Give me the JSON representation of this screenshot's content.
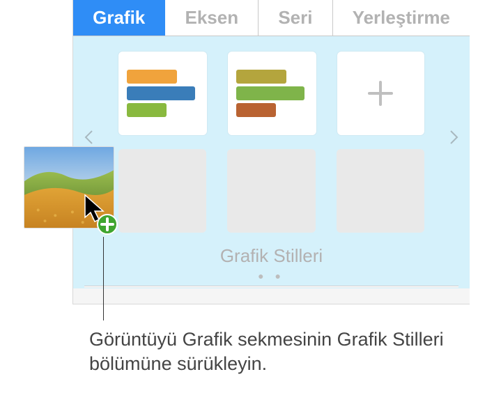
{
  "tabs": {
    "chart": "Grafik",
    "axis": "Eksen",
    "series": "Seri",
    "arrange": "Yerleştirme"
  },
  "styles": {
    "swatch1": {
      "c1": "#f0a33c",
      "c2": "#3a7db9",
      "c3": "#89b93f"
    },
    "swatch2": {
      "c1": "#b4a53d",
      "c2": "#7fb44a",
      "c3": "#b96332"
    },
    "title": "Grafik Stilleri"
  },
  "pager": {
    "dots": "● ●"
  },
  "callout": {
    "text": "Görüntüyü Grafik sekmesinin Grafik Stilleri bölümüne sürükleyin."
  }
}
